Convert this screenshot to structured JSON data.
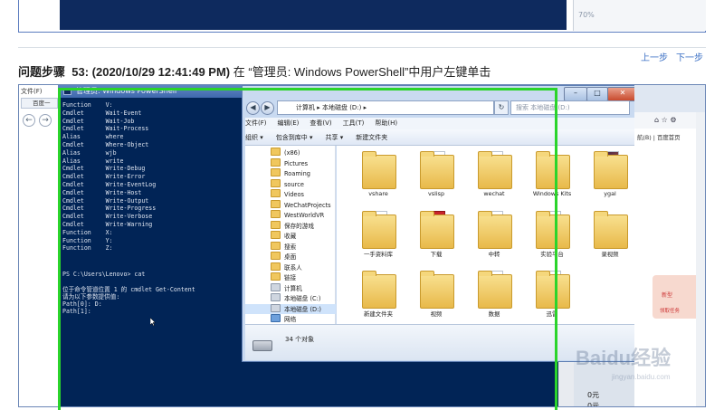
{
  "top_preview": {
    "percent_label": "70%"
  },
  "nav": {
    "prev_step": "上一步",
    "next_step": "下一步"
  },
  "step": {
    "prefix": "问题步骤",
    "number_time": "53: (2020/10/29 12:41:49 PM)",
    "description": "在 “管理员: Windows PowerShell”中用户左键单击"
  },
  "left_strip": {
    "menu": "文件(F)",
    "tab_label": "百度一",
    "back": "←",
    "forward": "→"
  },
  "powershell": {
    "title": "管理员: Windows PowerShell",
    "lines": [
      "Function    V:",
      "Cmdlet      Wait-Event",
      "Cmdlet      Wait-Job",
      "Cmdlet      Wait-Process",
      "Alias       where",
      "Cmdlet      Where-Object",
      "Alias       wjb",
      "Alias       write",
      "Cmdlet      Write-Debug",
      "Cmdlet      Write-Error",
      "Cmdlet      Write-EventLog",
      "Cmdlet      Write-Host",
      "Cmdlet      Write-Output",
      "Cmdlet      Write-Progress",
      "Cmdlet      Write-Verbose",
      "Cmdlet      Write-Warning",
      "Function    X:",
      "Function    Y:",
      "Function    Z:"
    ],
    "prompt": "PS C:\\Users\\Lenovo> cat",
    "message": "位于命令管道位置 1 的 cmdlet Get-Content\n请为以下参数提供值:\nPath[0]: D:\nPath[1]:"
  },
  "explorer": {
    "address": "计算机 ▸ 本地磁盘 (D:) ▸",
    "search_placeholder": "搜索 本地磁盘 (D:)",
    "menus": [
      "文件(F)",
      "编辑(E)",
      "查看(V)",
      "工具(T)",
      "帮助(H)"
    ],
    "toolbar": [
      "组织 ▾",
      "包含到库中 ▾",
      "共享 ▾",
      "新建文件夹"
    ],
    "nav_items": [
      {
        "label": "(x86)",
        "icon": "folder"
      },
      {
        "label": "Pictures",
        "icon": "folder"
      },
      {
        "label": "Roaming",
        "icon": "folder"
      },
      {
        "label": "source",
        "icon": "folder"
      },
      {
        "label": "Videos",
        "icon": "folder"
      },
      {
        "label": "WeChatProjects",
        "icon": "folder"
      },
      {
        "label": "WestWorldVR",
        "icon": "folder"
      },
      {
        "label": "保存的游戏",
        "icon": "folder"
      },
      {
        "label": "收藏",
        "icon": "folder"
      },
      {
        "label": "搜索",
        "icon": "folder"
      },
      {
        "label": "桌面",
        "icon": "folder"
      },
      {
        "label": "联系人",
        "icon": "folder"
      },
      {
        "label": "链接",
        "icon": "folder"
      },
      {
        "label": "计算机",
        "icon": "computer"
      },
      {
        "label": "本地磁盘 (C:)",
        "icon": "drive"
      },
      {
        "label": "本地磁盘 (D:)",
        "icon": "drive"
      },
      {
        "label": "网络",
        "icon": "network"
      }
    ],
    "folders": [
      {
        "label": "vshare",
        "type": "plain"
      },
      {
        "label": "vslisp",
        "type": "docs"
      },
      {
        "label": "wechat",
        "type": "docs"
      },
      {
        "label": "Windows Kits",
        "type": "plain"
      },
      {
        "label": "ygal",
        "type": "image"
      },
      {
        "label": "一手资料库",
        "type": "docs"
      },
      {
        "label": "下载",
        "type": "red"
      },
      {
        "label": "中转",
        "type": "docs"
      },
      {
        "label": "实验平台",
        "type": "docs"
      },
      {
        "label": "录视频",
        "type": "plain"
      },
      {
        "label": "新建文件夹",
        "type": "plain"
      },
      {
        "label": "视频",
        "type": "plain"
      },
      {
        "label": "数据",
        "type": "docs"
      },
      {
        "label": "迅雷",
        "type": "docs"
      }
    ],
    "status": "34 个对象"
  },
  "right_panel": {
    "sites": "航(B) | 百度首页",
    "ad_line1": "新型",
    "ad_line2": "领取任务",
    "price": "0元",
    "price2": "0元"
  },
  "watermark": {
    "text": "Baidu经验",
    "url": "jingyan.baidu.com"
  }
}
